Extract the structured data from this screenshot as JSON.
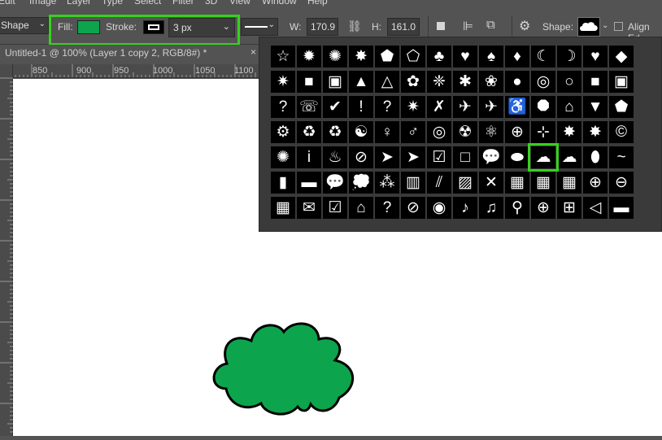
{
  "menubar": [
    "Edit",
    "Image",
    "Layer",
    "Type",
    "Select",
    "Filter",
    "3D",
    "View",
    "Window",
    "Help"
  ],
  "options": {
    "mode_label": "Shape",
    "fill_label": "Fill:",
    "fill_color": "#0ca44c",
    "stroke_label": "Stroke:",
    "stroke_width": "3 px",
    "w_label": "W:",
    "w_value": "170.9",
    "h_label": "H:",
    "h_value": "161.0",
    "shape_label": "Shape:",
    "align_label": "Align Ed"
  },
  "tab": {
    "title": "Untitled-1 @ 100% (Layer 1 copy 2, RGB/8#) *",
    "close": "×"
  },
  "ruler": {
    "ticks": [
      "850",
      "900",
      "950",
      "1000",
      "1050",
      "1100"
    ]
  },
  "shapes_grid": {
    "rows": [
      [
        "☆",
        "✹",
        "✺",
        "✸",
        "⬟",
        "⬠",
        "♣",
        "♥",
        "♠",
        "♦",
        "☾",
        "☽",
        "♥",
        "◆"
      ],
      [
        "✷",
        "■",
        "▣",
        "▲",
        "△",
        "✿",
        "❈",
        "✱",
        "❀",
        "●",
        "◎",
        "○",
        "■",
        "▣"
      ],
      [
        "?",
        "☏",
        "✔",
        "!",
        "?",
        "✷",
        "✗",
        "✈",
        "✈",
        "♿",
        "⯃",
        "⌂",
        "▼",
        "⬟"
      ],
      [
        "⚙",
        "♻",
        "♻",
        "☯",
        "♀",
        "♂",
        "◎",
        "☢",
        "⚛",
        "⊕",
        "⊹",
        "✸",
        "✸",
        "©"
      ],
      [
        "✺",
        "i",
        "♨",
        "⊘",
        "➤",
        "➤",
        "☑",
        "□",
        "💬",
        "⬬",
        "☁",
        "☁",
        "⬮",
        "~"
      ],
      [
        "▮",
        "▬",
        "💬",
        "💭",
        "⁂",
        "▥",
        "⫽",
        "▨",
        "✕",
        "▦",
        "▦",
        "▦",
        "⊕",
        "⊖"
      ],
      [
        "▦",
        "✉",
        "☑",
        "⌂",
        "?",
        "⊘",
        "◉",
        "♪",
        "♫",
        "⚲",
        "⊕",
        "⊞",
        "◁",
        "▬"
      ]
    ],
    "selected_row": 4,
    "selected_col": 10
  },
  "colors": {
    "highlight": "#36d11e",
    "shape_fill": "#0ca44c",
    "shape_stroke": "#000000"
  },
  "icons": [
    "chain-link-icon",
    "gear-icon",
    "path-align-icon",
    "path-ops-icon",
    "cloud-shape-icon",
    "shape-cloud-icon"
  ]
}
